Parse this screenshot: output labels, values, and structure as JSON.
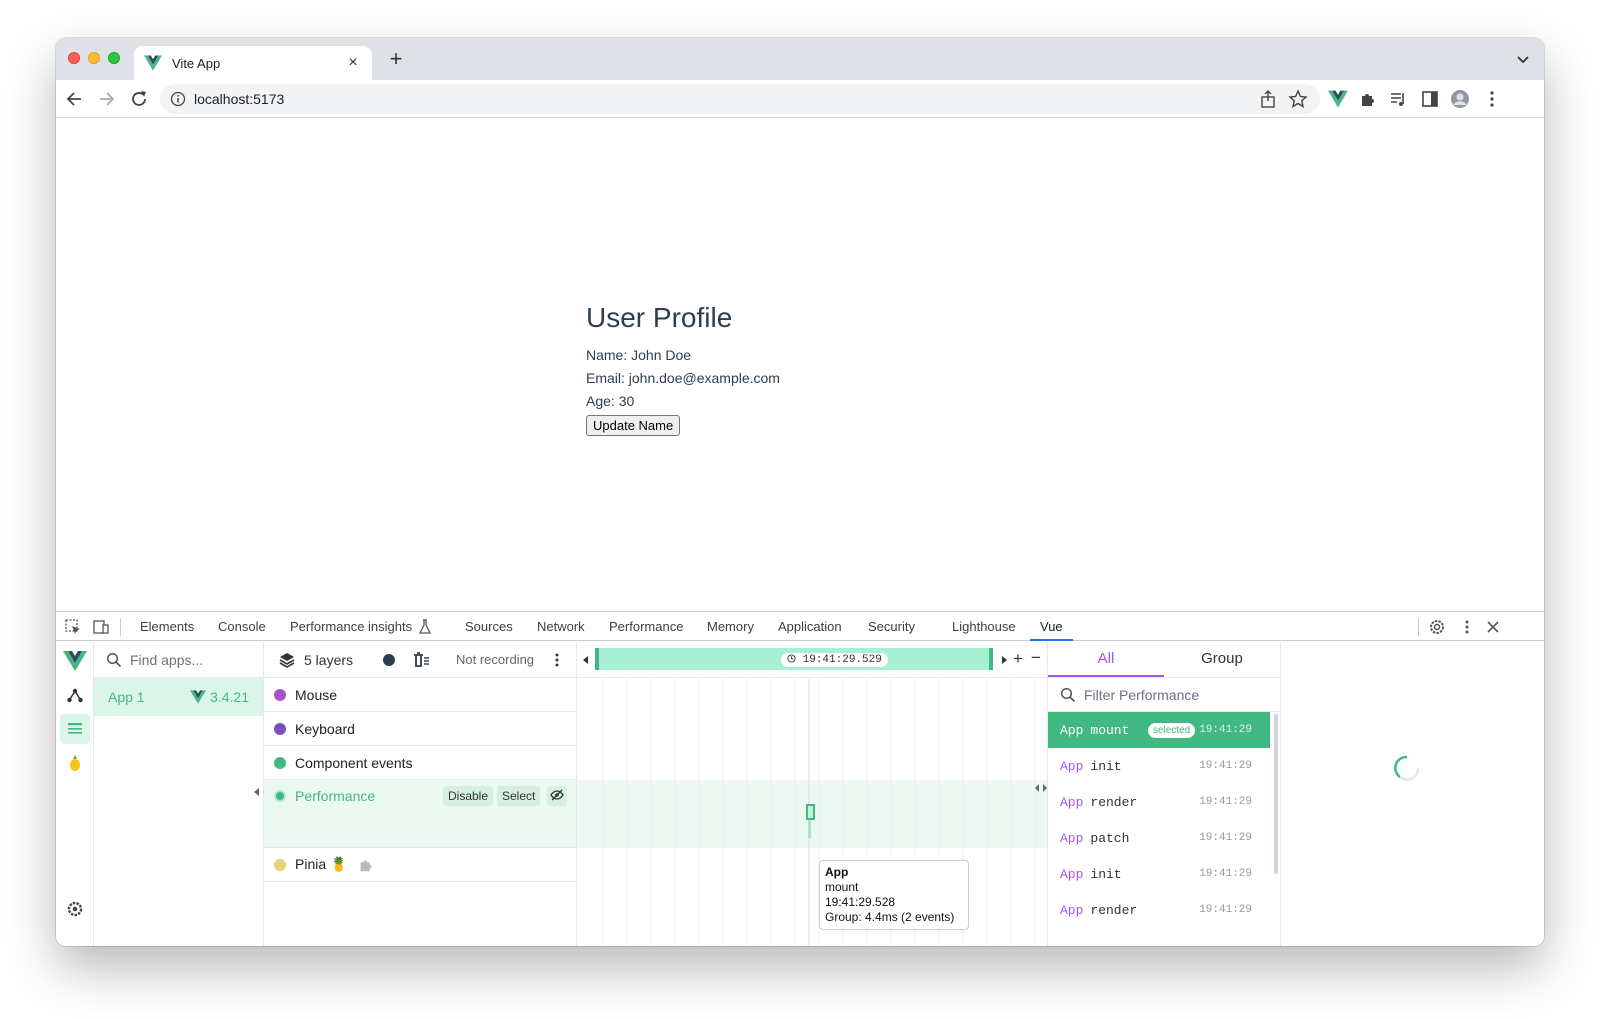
{
  "browser": {
    "tab_title": "Vite App",
    "new_tab": "+",
    "url": "localhost:5173"
  },
  "page": {
    "heading": "User Profile",
    "name_line": "Name: John Doe",
    "email_line": "Email: john.doe@example.com",
    "age_line": "Age: 30",
    "button_label": "Update Name"
  },
  "devtools": {
    "tabs": [
      "Elements",
      "Console",
      "Performance insights",
      "Sources",
      "Network",
      "Performance",
      "Memory",
      "Application",
      "Security",
      "Lighthouse",
      "Vue"
    ],
    "active_tab": "Vue"
  },
  "vue": {
    "apps_search_placeholder": "Find apps...",
    "app_name": "App 1",
    "app_version": "3.4.21",
    "layers_count": "5 layers",
    "recording_status": "Not recording",
    "layers": [
      {
        "label": "Mouse",
        "color": "#a855c7"
      },
      {
        "label": "Keyboard",
        "color": "#7c4dbd"
      },
      {
        "label": "Component events",
        "color": "#42b883"
      },
      {
        "label": "Performance",
        "color": "#42b883"
      },
      {
        "label": "Pinia 🍍",
        "color": "#e6d27a"
      }
    ],
    "layer_actions": {
      "disable": "Disable",
      "select": "Select"
    },
    "timeline_time": "19:41:29.529",
    "tooltip": {
      "title": "App",
      "event": "mount",
      "time": "19:41:29.528",
      "group": "Group: 4.4ms (2 events)"
    },
    "perf_tabs": {
      "all": "All",
      "group": "Group"
    },
    "filter_placeholder": "Filter Performance",
    "selected_badge": "selected",
    "events": [
      {
        "comp": "App",
        "name": "mount",
        "time": "19:41:29"
      },
      {
        "comp": "App",
        "name": "init",
        "time": "19:41:29"
      },
      {
        "comp": "App",
        "name": "render",
        "time": "19:41:29"
      },
      {
        "comp": "App",
        "name": "patch",
        "time": "19:41:29"
      },
      {
        "comp": "App",
        "name": "init",
        "time": "19:41:29"
      },
      {
        "comp": "App",
        "name": "render",
        "time": "19:41:29"
      }
    ]
  },
  "colors": {
    "vue_green": "#42b883",
    "accent_purple": "#a855f7",
    "devtools_blue": "#1a73e8"
  }
}
